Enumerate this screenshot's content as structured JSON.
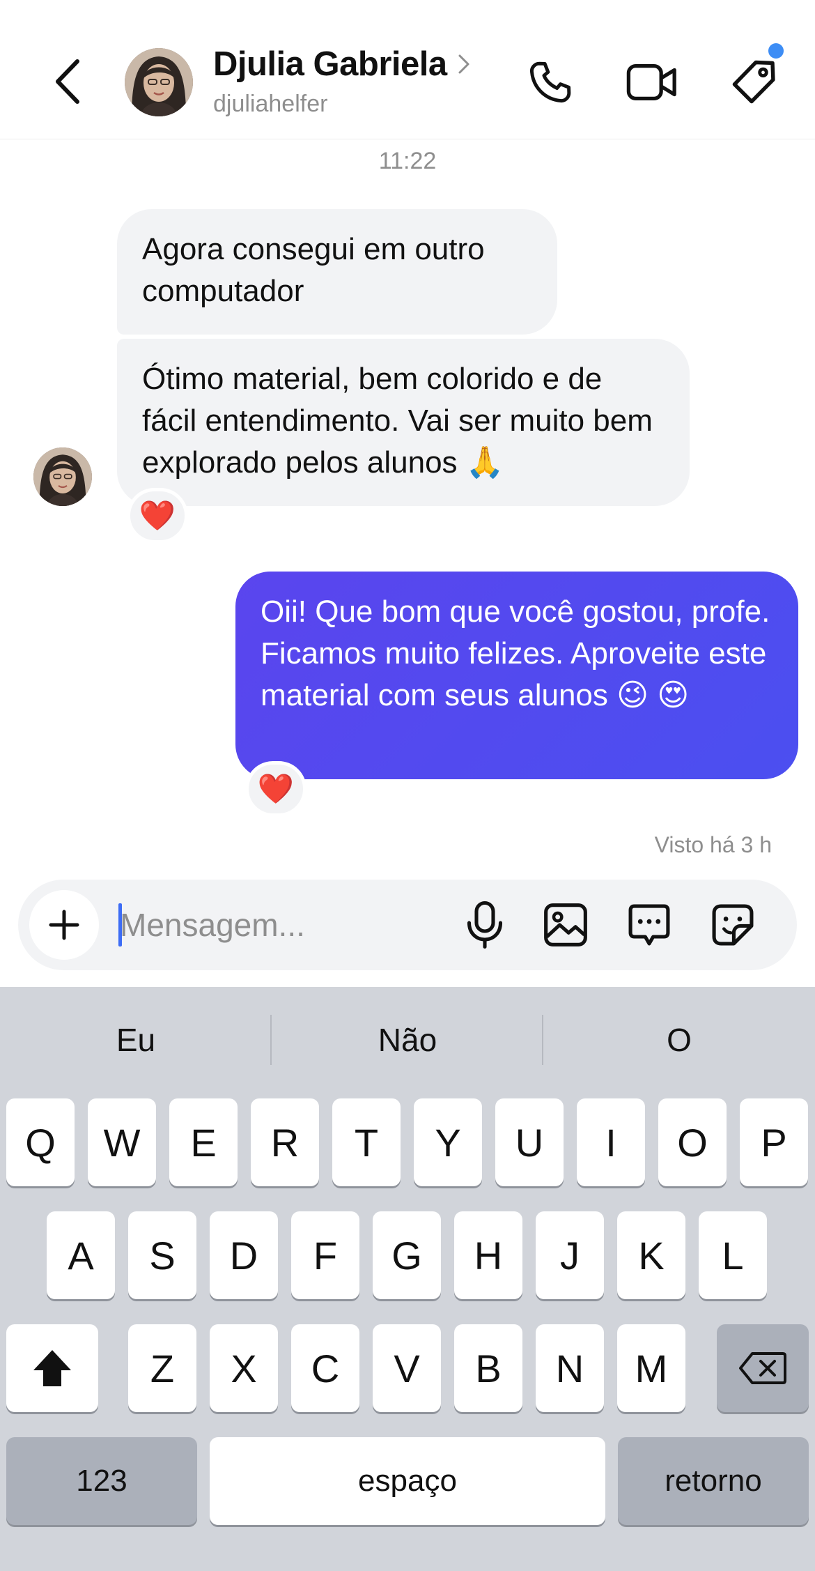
{
  "header": {
    "name": "Djulia Gabriela",
    "handle": "djuliahelfer",
    "icons": [
      "back-chevron-icon",
      "chevron-right-icon",
      "phone-icon",
      "video-camera-icon",
      "tag-icon"
    ],
    "notification_dot_color": "#3d8df5"
  },
  "conversation": {
    "timestamp": "11:22",
    "messages": [
      {
        "from": "contact",
        "text": "Agora consegui em outro computador"
      },
      {
        "from": "contact",
        "text": "Ótimo material, bem colorido e de fácil entendimento. Vai ser muito bem explorado pelos alunos 🙏",
        "reaction": "❤️"
      },
      {
        "from": "me",
        "text": "Oii! Que bom que você gostou, profe. Ficamos muito felizes. Aproveite este material com seus alunos 😉 😍",
        "reaction": "❤️"
      }
    ],
    "seen": "Visto há 3 h",
    "outgoing_color": "#5047ef",
    "incoming_color": "#f2f3f5"
  },
  "composer": {
    "placeholder": "Mensagem...",
    "value": "",
    "icons": [
      "plus-icon",
      "microphone-icon",
      "image-icon",
      "chat-bubble-icon",
      "sticker-icon"
    ]
  },
  "keyboard": {
    "suggestions": [
      "Eu",
      "Não",
      "O"
    ],
    "row1": [
      "Q",
      "W",
      "E",
      "R",
      "T",
      "Y",
      "U",
      "I",
      "O",
      "P"
    ],
    "row2": [
      "A",
      "S",
      "D",
      "F",
      "G",
      "H",
      "J",
      "K",
      "L"
    ],
    "row3": [
      "Z",
      "X",
      "C",
      "V",
      "B",
      "N",
      "M"
    ],
    "numbers": "123",
    "space": "espaço",
    "return": "retorno"
  }
}
